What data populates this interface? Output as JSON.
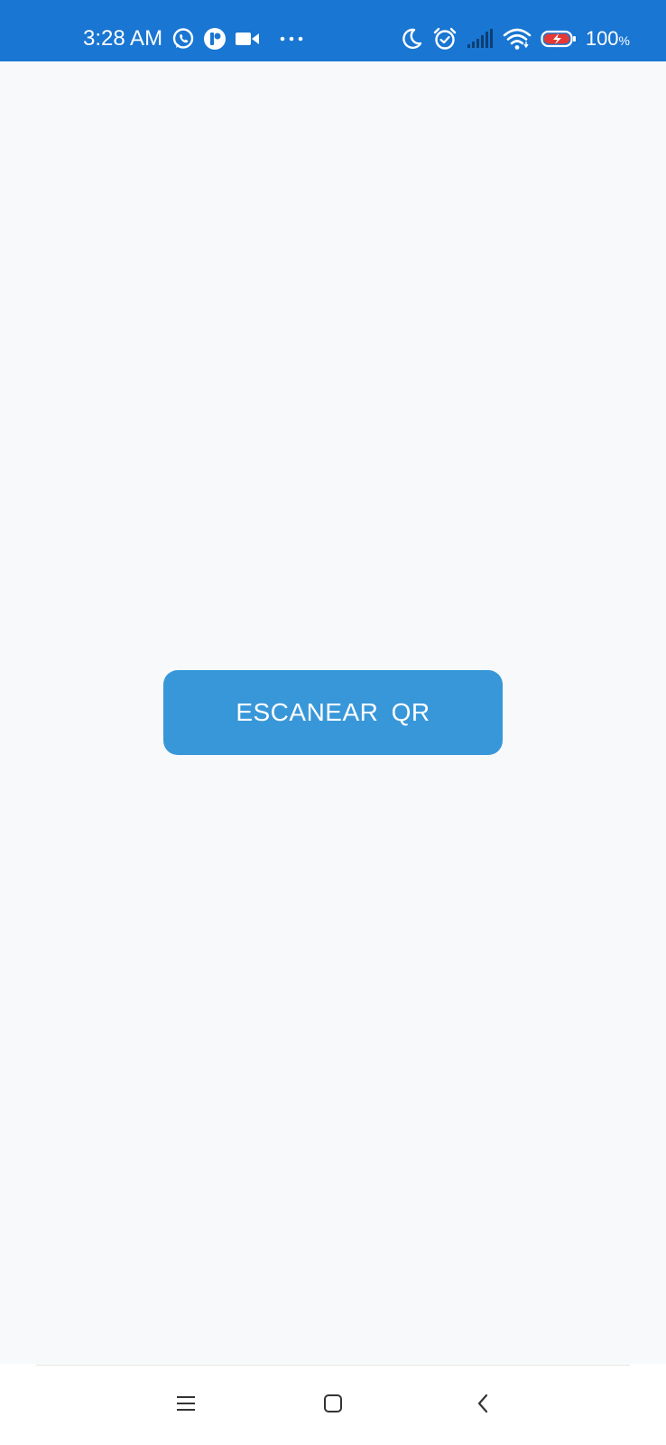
{
  "status_bar": {
    "time": "3:28 AM",
    "left_icons": [
      "whatsapp-icon",
      "app-notification-icon",
      "video-camera-icon",
      "more-dots-icon"
    ],
    "right_icons": [
      "moon-icon",
      "alarm-icon",
      "signal-icon",
      "wifi-icon",
      "battery-charging-icon"
    ],
    "battery_level": "100",
    "battery_unit": "%",
    "background_color": "#1976d2"
  },
  "main": {
    "scan_button_label": "ESCANEAR  QR",
    "button_color": "#3897d9",
    "background_color": "#f8f9fa"
  },
  "nav_bar": {
    "buttons": [
      "menu-icon",
      "home-icon",
      "back-icon"
    ]
  }
}
